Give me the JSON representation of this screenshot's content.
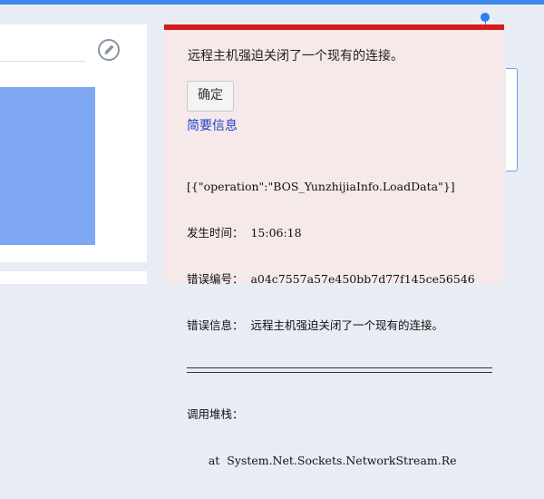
{
  "dialog": {
    "message": "远程主机强迫关闭了一个现有的连接。",
    "ok_label": "确定",
    "summary_link": "简要信息",
    "details": [
      "[{\"operation\":\"BOS_YunzhijiaInfo.LoadData\"}]",
      "发生时间：  15:06:18",
      "错误编号：  a04c7557a57e450bb7d77f145ce56546",
      "错误信息：  远程主机强迫关闭了一个现有的连接。"
    ],
    "stack_label": "调用堆栈：",
    "stack_line": "      at  System.Net.Sockets.NetworkStream.Re"
  },
  "icons": {
    "edit": "edit-icon"
  },
  "colors": {
    "dialog_bg": "#f5e9e9",
    "error_bar": "#d91a1a",
    "link": "#1f3fc8",
    "accent": "#3f86e8"
  }
}
